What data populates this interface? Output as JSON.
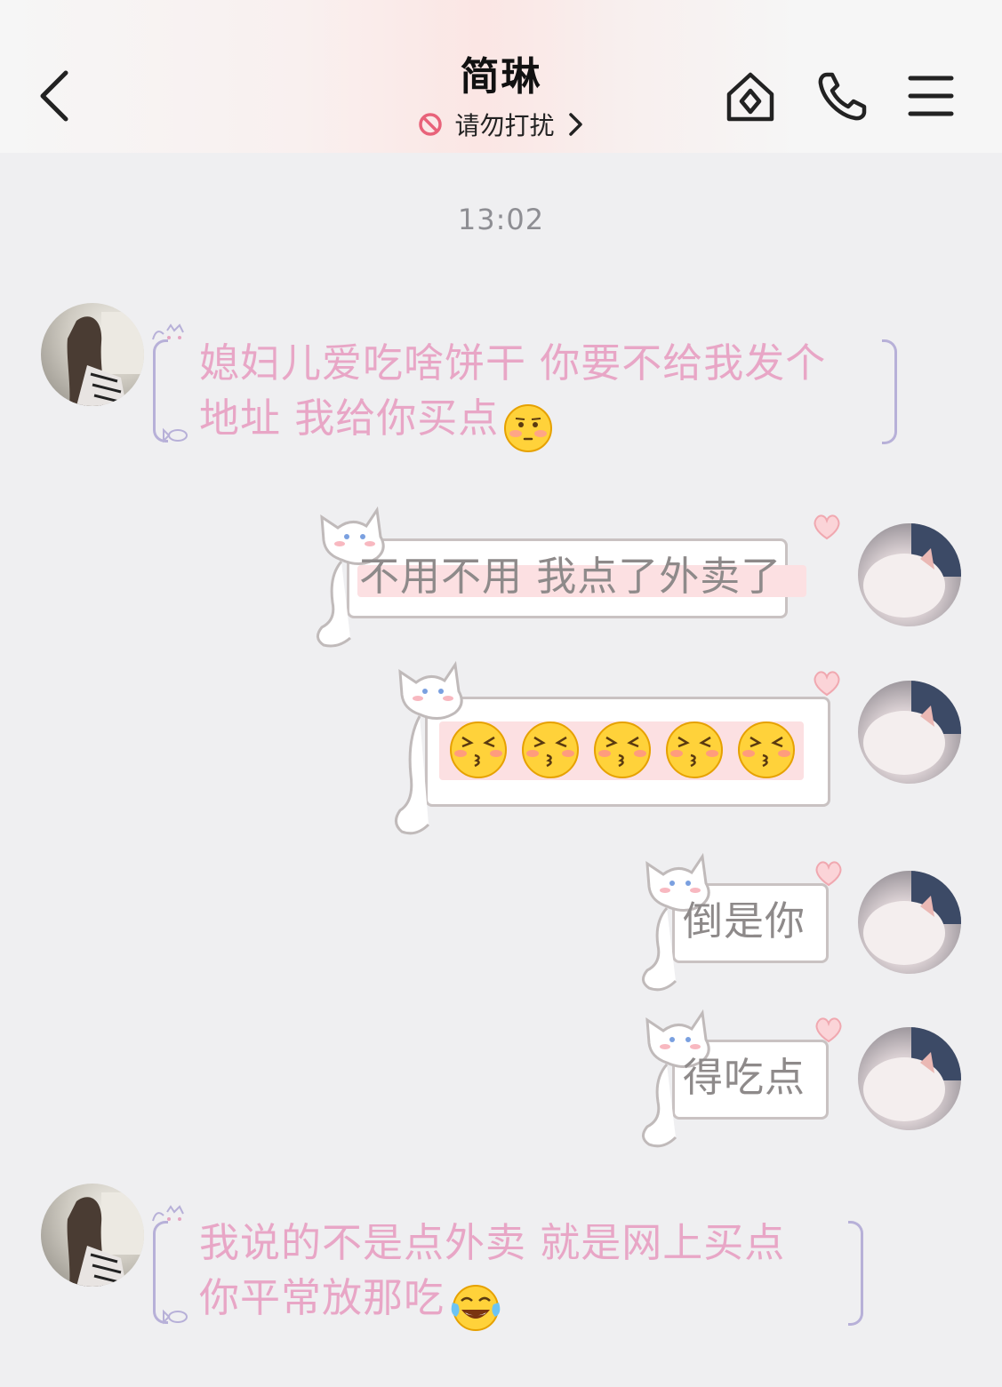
{
  "header": {
    "contact_name": "简琳",
    "status_text": "请勿打扰",
    "icons": [
      "back-chevron-icon",
      "do-not-disturb-icon",
      "chevron-right-icon",
      "home-diamond-icon",
      "phone-icon",
      "menu-icon"
    ]
  },
  "chat": {
    "timestamp": "13:02",
    "messages": [
      {
        "side": "left",
        "line1": "媳妇儿爱吃啥饼干 你要不给我发个",
        "line2": "地址 我给你买点",
        "emoji": "flushed-face"
      },
      {
        "side": "right",
        "text": "不用不用 我点了外卖了"
      },
      {
        "side": "right",
        "emoji_count": 5,
        "emoji": "kissing-face"
      },
      {
        "side": "right",
        "text": "倒是你"
      },
      {
        "side": "right",
        "text": "得吃点"
      },
      {
        "side": "left",
        "line1": "我说的不是点外卖 就是网上买点",
        "line2": "你平常放那吃",
        "emoji": "tears-of-joy-face"
      }
    ]
  },
  "colors": {
    "peer_text": "#e8a6c6",
    "self_text": "#8e8a8a",
    "background": "#efeff1",
    "bracket": "#b7b0d8"
  }
}
